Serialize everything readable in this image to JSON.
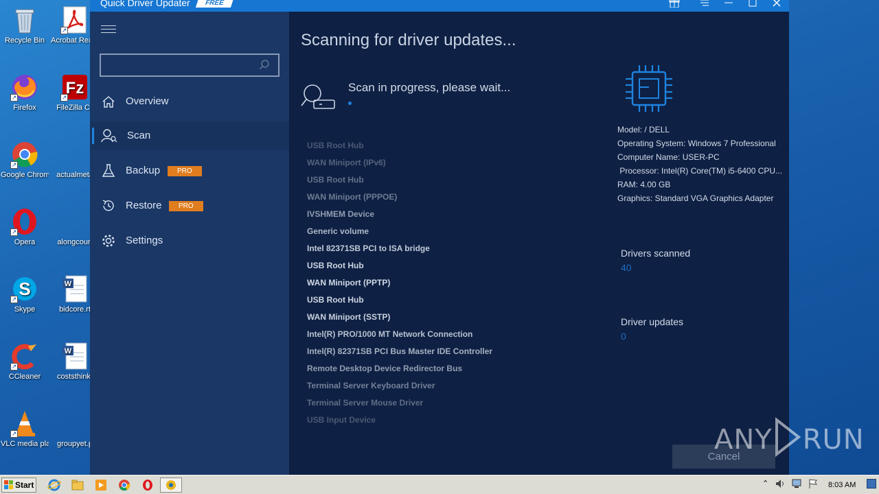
{
  "desktop": {
    "icons": [
      {
        "label": "Recycle Bin"
      },
      {
        "label": "Acrobat Reader D"
      },
      {
        "label": "Firefox"
      },
      {
        "label": "FileZilla Cli"
      },
      {
        "label": "Google Chrome"
      },
      {
        "label": "actualmeta"
      },
      {
        "label": "Opera"
      },
      {
        "label": "alongcourt"
      },
      {
        "label": "Skype"
      },
      {
        "label": "bidcore.rt"
      },
      {
        "label": "CCleaner"
      },
      {
        "label": "coststhink."
      },
      {
        "label": "VLC media player"
      },
      {
        "label": "groupyet.p"
      }
    ]
  },
  "app": {
    "title": "Quick Driver Updater",
    "badge": "FREE",
    "search": {
      "value": "",
      "placeholder": ""
    },
    "nav": [
      {
        "label": "Overview",
        "icon": "home-icon"
      },
      {
        "label": "Scan",
        "icon": "scan-user-icon",
        "active": true
      },
      {
        "label": "Backup",
        "icon": "flask-icon",
        "badge": "PRO"
      },
      {
        "label": "Restore",
        "icon": "restore-icon",
        "badge": "PRO"
      },
      {
        "label": "Settings",
        "icon": "gear-icon"
      }
    ],
    "main": {
      "title": "Scanning for driver updates...",
      "status": "Scan in progress, please wait...",
      "drivers": [
        "USB Root Hub",
        "WAN Miniport (IPv6)",
        "USB Root Hub",
        "WAN Miniport (PPPOE)",
        "IVSHMEM Device",
        "Generic volume",
        "Intel 82371SB PCI to ISA bridge",
        "USB Root Hub",
        "WAN Miniport (PPTP)",
        "USB Root Hub",
        "WAN Miniport (SSTP)",
        "Intel(R) PRO/1000 MT Network Connection",
        "Intel(R) 82371SB PCI Bus Master IDE Controller",
        "Remote Desktop Device Redirector Bus",
        "Terminal Server Keyboard Driver",
        "Terminal Server Mouse Driver",
        "USB Input Device"
      ],
      "driver_opacity": [
        0.28,
        0.33,
        0.4,
        0.45,
        0.62,
        0.75,
        0.85,
        0.9,
        0.92,
        0.9,
        0.88,
        0.8,
        0.72,
        0.62,
        0.48,
        0.38,
        0.28
      ],
      "sysinfo": {
        "model": "Model:  / DELL",
        "os": "Operating System: Windows 7 Professional",
        "computer": "Computer Name: USER-PC",
        "processor": " Processor: Intel(R) Core(TM) i5-6400 CPU...",
        "ram": "RAM: 4.00 GB",
        "graphics": "Graphics: Standard VGA Graphics Adapter"
      },
      "stats": {
        "scanned_label": "Drivers scanned",
        "scanned_value": "40",
        "updates_label": "Driver updates",
        "updates_value": "0"
      },
      "cancel_label": "Cancel"
    }
  },
  "watermark": {
    "left": "ANY",
    "right": "RUN"
  },
  "taskbar": {
    "start_label": "Start",
    "clock": "8:03 AM"
  },
  "colors": {
    "accent": "#1e84e0",
    "pro_badge": "#e07d1f",
    "sidebar": "#1a3766",
    "main_bg": "#0e2043"
  }
}
